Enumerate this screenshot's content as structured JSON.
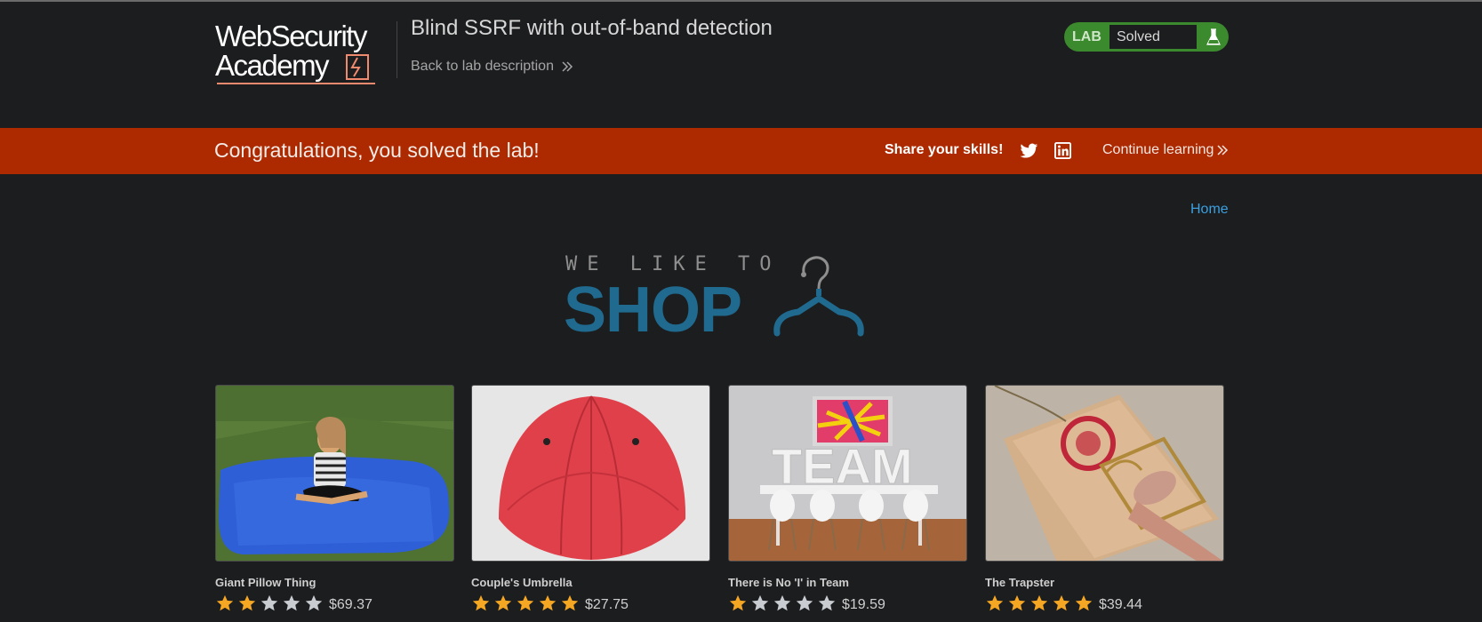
{
  "header": {
    "logo_line1": "WebSecurity",
    "logo_line2": "Academy",
    "lab_title": "Blind SSRF with out-of-band detection",
    "back_link": "Back to lab description",
    "lab_badge": "LAB",
    "lab_status": "Solved"
  },
  "banner": {
    "message": "Congratulations, you solved the lab!",
    "share_label": "Share your skills!",
    "continue_label": "Continue learning"
  },
  "nav": {
    "home": "Home"
  },
  "shop_logo": {
    "line1": "WE LIKE TO",
    "line2": "SHOP"
  },
  "colors": {
    "banner": "#ad2a00",
    "lab_green": "#3b8a2e",
    "link_blue": "#3aa0e0",
    "star_gold": "#f5a623"
  },
  "products": [
    {
      "name": "Giant Pillow Thing",
      "price": "$69.37",
      "rating": 2,
      "image": "blue giant bean bag pillow with child on grass"
    },
    {
      "name": "Couple's Umbrella",
      "price": "$27.75",
      "rating": 5,
      "image": "red double umbrella"
    },
    {
      "name": "There is No 'I' in Team",
      "price": "$19.59",
      "rating": 1,
      "image": "TEAM letters on meeting table"
    },
    {
      "name": "The Trapster",
      "price": "$39.44",
      "rating": 5,
      "image": "mouse trap with finger"
    }
  ]
}
